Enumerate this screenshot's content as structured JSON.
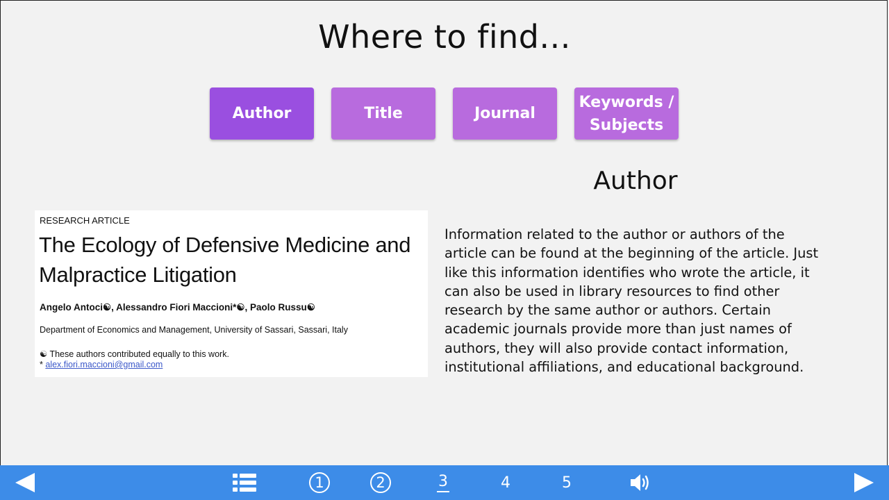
{
  "title": "Where to find...",
  "tabs": [
    {
      "label": "Author",
      "active": true
    },
    {
      "label": "Title",
      "active": false
    },
    {
      "label": "Journal",
      "active": false
    },
    {
      "label": "Keywords /\nSubjects",
      "active": false
    }
  ],
  "section": {
    "heading": "Author",
    "body": "Information related to the author or authors of the article can be found at the beginning of the article. Just like this information identifies who wrote the article, it can also be used in library resources to find other research by the same author or authors. Certain academic journals provide more than just names of authors, they will also provide contact information, institutional affiliations, and educational background."
  },
  "article": {
    "label": "RESEARCH ARTICLE",
    "title": "The Ecology of Defensive Medicine and Malpractice Litigation",
    "authors": "Angelo Antoci☯, Alessandro Fiori Maccioni*☯, Paolo Russu☯",
    "affiliation": "Department of Economics and Management, University of Sassari, Sassari, Italy",
    "note": "☯ These authors contributed equally to this work.",
    "email_marker": "*",
    "email": "alex.fiori.maccioni@gmail.com"
  },
  "nav": {
    "pages": [
      "1",
      "2",
      "3",
      "4",
      "5"
    ],
    "visited_pages": [
      1,
      2
    ],
    "current_page": 3,
    "prev_icon": "triangle-left-icon",
    "next_icon": "triangle-right-icon",
    "menu_icon": "list-icon",
    "sound_icon": "speaker-icon"
  },
  "colors": {
    "tab_active": "#9a4fe0",
    "tab_inactive": "#b86bde",
    "bottom_bar": "#3d8ce8",
    "background": "#f2f2f2"
  }
}
